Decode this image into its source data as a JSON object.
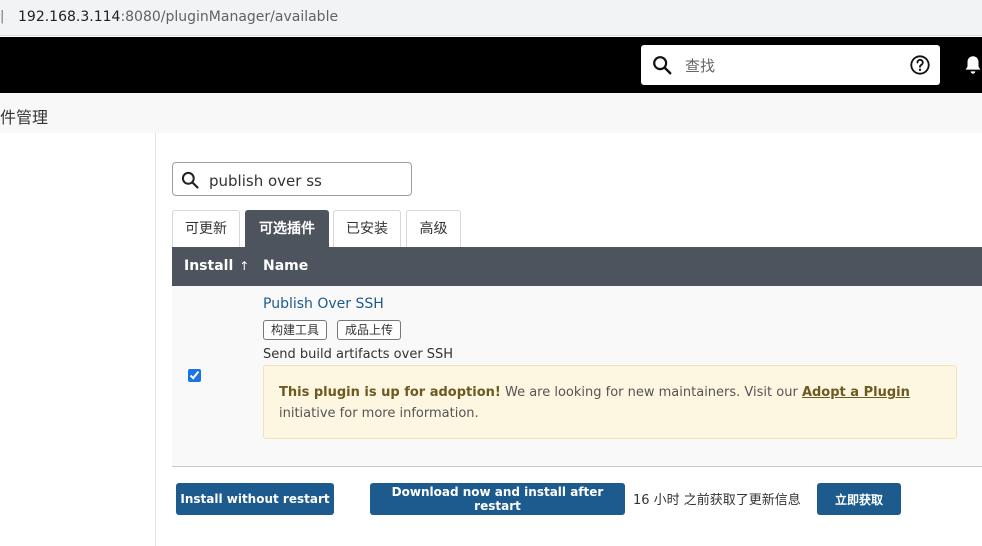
{
  "browser": {
    "separator": "|",
    "url_host": "192.168.3.114",
    "url_rest": ":8080/pluginManager/available"
  },
  "header": {
    "search_placeholder": "查找",
    "icons": [
      "search-icon",
      "help-icon",
      "bell-icon"
    ]
  },
  "breadcrumb": {
    "title": "件管理"
  },
  "filter": {
    "value": "publish over ss"
  },
  "tabs": [
    {
      "label": "可更新",
      "active": false
    },
    {
      "label": "可选插件",
      "active": true
    },
    {
      "label": "已安装",
      "active": false
    },
    {
      "label": "高级",
      "active": false
    }
  ],
  "table": {
    "columns": {
      "install": "Install",
      "install_sort": "↑",
      "name": "Name"
    },
    "rows": [
      {
        "checked": true,
        "name": "Publish Over SSH",
        "tags": [
          "构建工具",
          "成品上传"
        ],
        "excerpt": "Send build artifacts over SSH",
        "adoption": {
          "bold": "This plugin is up for adoption!",
          "text": " We are looking for new maintainers. Visit our ",
          "link": "Adopt a Plugin",
          "tail": " initiative for more information."
        }
      }
    ]
  },
  "actions": {
    "install_without_restart": "Install without restart",
    "download_install_after_restart": "Download now and install after restart",
    "update_status": "16 小时 之前获取了更新信息",
    "check_now": "立即获取"
  },
  "colors": {
    "header_bg": "#000000",
    "table_head_bg": "#4d545d",
    "button_bg": "#1d5a8e",
    "adoption_bg": "#fdf6e1",
    "link": "#1d5a8e"
  }
}
